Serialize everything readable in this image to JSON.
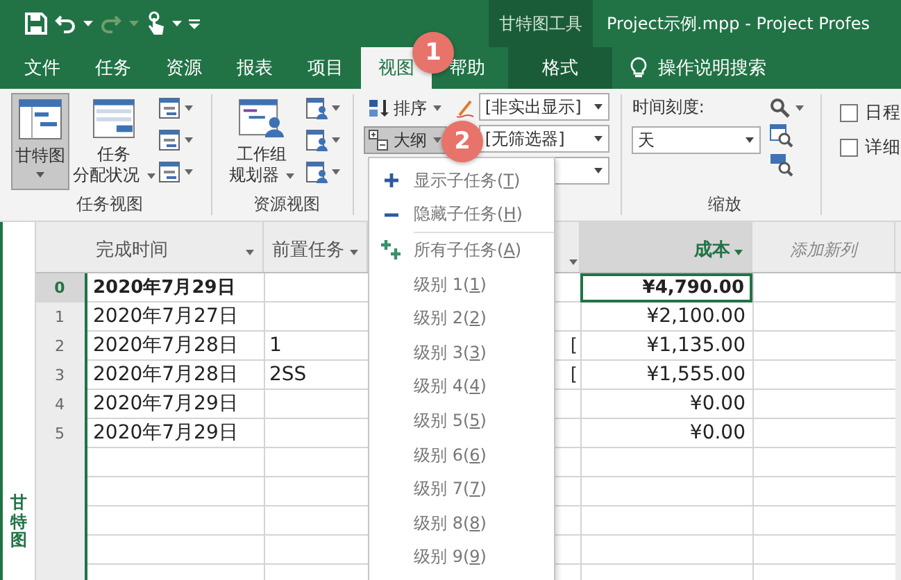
{
  "title": {
    "context_group": "甘特图工具",
    "text": "Project示例.mpp  -  Project Profes"
  },
  "tabs": [
    {
      "label": "文件",
      "selected": false
    },
    {
      "label": "任务",
      "selected": false
    },
    {
      "label": "资源",
      "selected": false
    },
    {
      "label": "报表",
      "selected": false
    },
    {
      "label": "项目",
      "selected": false
    },
    {
      "label": "视图",
      "selected": true
    },
    {
      "label": "帮助",
      "selected": false
    },
    {
      "label": "格式",
      "selected": false,
      "kind": "context"
    }
  ],
  "search": {
    "label": "操作说明搜索"
  },
  "ribbon": {
    "task_views": {
      "title": "任务视图",
      "gantt": {
        "label": "甘特图",
        "selected": true
      },
      "usage": {
        "line1": "任务",
        "line2": "分配状况"
      }
    },
    "resource_views": {
      "title": "资源视图",
      "planner": {
        "line1": "工作组",
        "line2": "规划器"
      }
    },
    "data": {
      "sort": "排序",
      "outline": {
        "label": "大纲",
        "selected": true
      },
      "highlight": "[非实出显示]",
      "filter": "[无筛选器]"
    },
    "zoom": {
      "title": "缩放",
      "timescale_label": "时间刻度:",
      "timescale": "天"
    },
    "show": [
      {
        "label": "日程",
        "checked": false
      },
      {
        "label": "详细",
        "checked": false
      }
    ]
  },
  "grid": {
    "side_label": "甘特图",
    "columns": [
      {
        "label": "完成时间",
        "selected": false
      },
      {
        "label": "前置任务",
        "selected": false
      },
      {
        "selected": false
      },
      {
        "label": "成本",
        "selected": true
      },
      {
        "label": "添加新列",
        "kind": "add",
        "selected": false
      }
    ],
    "rows": [
      {
        "id": "0",
        "finish": "2020年7月29日",
        "cost": "¥4,790.00",
        "summary": true,
        "selected": true
      },
      {
        "id": "1",
        "finish": "2020年7月27日",
        "cost": "¥2,100.00",
        "summary": false,
        "selected": false
      },
      {
        "id": "2",
        "finish": "2020年7月28日",
        "predecessors": "1",
        "column_3": "[",
        "cost": "¥1,135.00",
        "summary": false,
        "selected": false
      },
      {
        "id": "3",
        "finish": "2020年7月28日",
        "predecessors": "2SS",
        "column_3": "[",
        "cost": "¥1,555.00",
        "summary": false,
        "selected": false
      },
      {
        "id": "4",
        "finish": "2020年7月29日",
        "cost": "¥0.00",
        "summary": false,
        "selected": false
      },
      {
        "id": "5",
        "finish": "2020年7月29日",
        "cost": "¥0.00",
        "summary": false,
        "selected": false
      }
    ]
  },
  "outline_menu": [
    {
      "label": "显示子任务(T)",
      "kind": "show"
    },
    {
      "label": "隐藏子任务(H)",
      "kind": "hide"
    },
    {
      "label": "所有子任务(A)",
      "kind": "all",
      "divider_above": true
    },
    {
      "label": "级别 1(1)",
      "kind": "level"
    },
    {
      "label": "级别 2(2)",
      "kind": "level"
    },
    {
      "label": "级别 3(3)",
      "kind": "level"
    },
    {
      "label": "级别 4(4)",
      "kind": "level"
    },
    {
      "label": "级别 5(5)",
      "kind": "level"
    },
    {
      "label": "级别 6(6)",
      "kind": "level"
    },
    {
      "label": "级别 7(7)",
      "kind": "level"
    },
    {
      "label": "级别 8(8)",
      "kind": "level"
    },
    {
      "label": "级别 9(9)",
      "kind": "level"
    }
  ],
  "markers": [
    {
      "label": "1"
    },
    {
      "label": "2"
    }
  ]
}
